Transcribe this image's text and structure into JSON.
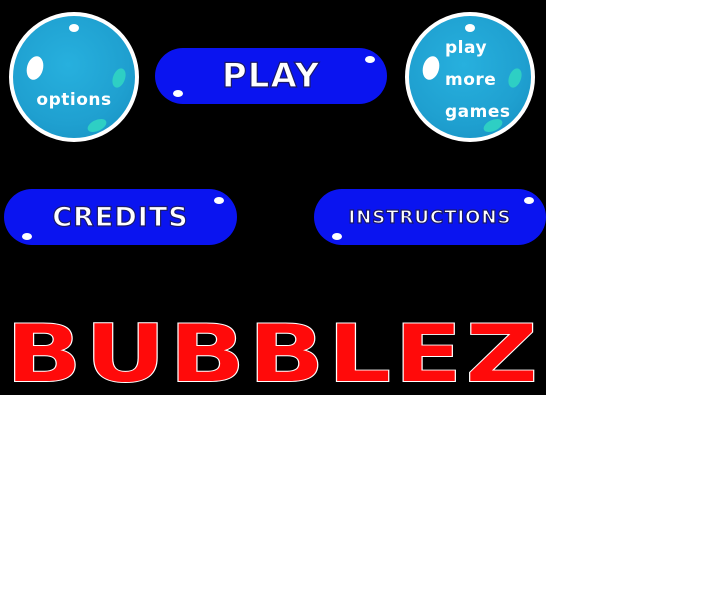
{
  "menu": {
    "options_label": "options",
    "play_label": "PLAY",
    "more_games_line1": "play",
    "more_games_line2": "more",
    "more_games_line3": "games",
    "credits_label": "CREDITS",
    "instructions_label": "INSTRUCTIONS"
  },
  "title": "BUBBLEZ",
  "colors": {
    "background": "#000000",
    "bubble_blue": "#1fa0d0",
    "pill_blue": "#0a14f0",
    "title_red": "#ff0a0a",
    "accent_teal": "#2ecfc4"
  }
}
